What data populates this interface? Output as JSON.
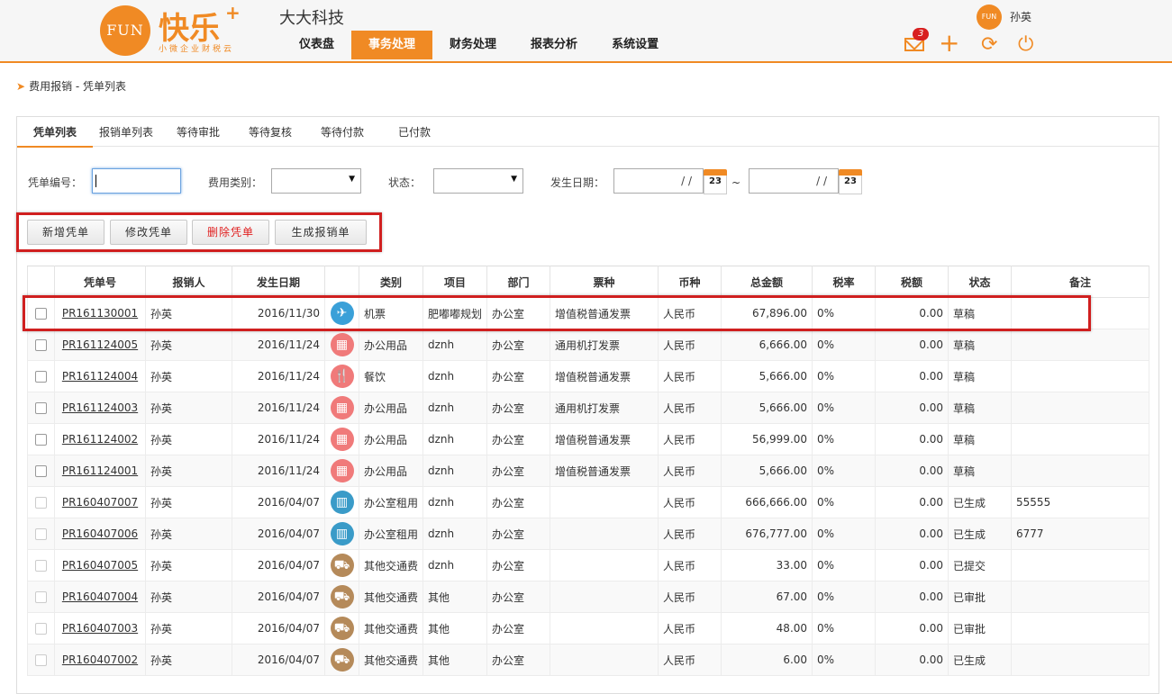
{
  "brand": {
    "logo_circle": "FUN",
    "name": "快乐",
    "plus": "+",
    "slogan": "小微企业财税云",
    "company": "大大科技"
  },
  "nav": [
    "仪表盘",
    "事务处理",
    "财务处理",
    "报表分析",
    "系统设置"
  ],
  "nav_active": "事务处理",
  "user": {
    "avatar": "FUN",
    "name": "孙英"
  },
  "toolbar": {
    "mail_badge": "3",
    "icons": [
      "mail-icon",
      "plus-icon",
      "refresh-icon",
      "power-icon"
    ]
  },
  "breadcrumb": "费用报销 - 凭单列表",
  "tabs": [
    "凭单列表",
    "报销单列表",
    "等待审批",
    "等待复核",
    "等待付款",
    "已付款"
  ],
  "filters": {
    "voucher_no_label": "凭单编号：",
    "category_label": "费用类别：",
    "status_label": "状态：",
    "date_label": "发生日期：",
    "date_placeholder": "/ /",
    "calendar_day": "23",
    "range_sep": "~"
  },
  "buttons": {
    "add": "新增凭单",
    "edit": "修改凭单",
    "delete": "删除凭单",
    "generate": "生成报销单"
  },
  "colors": {
    "accent": "#f08a24",
    "highlight": "#d01f1f",
    "delete_text": "#e02020"
  },
  "table": {
    "headers": [
      "",
      "凭单号",
      "报销人",
      "发生日期",
      "",
      "类别",
      "项目",
      "部门",
      "票种",
      "币种",
      "总金额",
      "税率",
      "税额",
      "状态",
      "备注"
    ],
    "rows": [
      {
        "id": "PR161130001",
        "person": "孙英",
        "date": "2016/11/30",
        "icon": "plane-icon",
        "icon_color": "#3aa0d8",
        "category": "机票",
        "project": "肥嘟嘟规划",
        "dept": "办公室",
        "ticket": "增值税普通发票",
        "currency": "人民币",
        "amount": "67,896.00",
        "tax_rate": "0%",
        "tax": "0.00",
        "status": "草稿",
        "note": ""
      },
      {
        "id": "PR161124005",
        "person": "孙英",
        "date": "2016/11/24",
        "icon": "calculator-icon",
        "icon_color": "#f07a7a",
        "category": "办公用品",
        "project": "dznh",
        "dept": "办公室",
        "ticket": "通用机打发票",
        "currency": "人民币",
        "amount": "6,666.00",
        "tax_rate": "0%",
        "tax": "0.00",
        "status": "草稿",
        "note": ""
      },
      {
        "id": "PR161124004",
        "person": "孙英",
        "date": "2016/11/24",
        "icon": "dining-icon",
        "icon_color": "#f07a7a",
        "category": "餐饮",
        "project": "dznh",
        "dept": "办公室",
        "ticket": "增值税普通发票",
        "currency": "人民币",
        "amount": "5,666.00",
        "tax_rate": "0%",
        "tax": "0.00",
        "status": "草稿",
        "note": ""
      },
      {
        "id": "PR161124003",
        "person": "孙英",
        "date": "2016/11/24",
        "icon": "calculator-icon",
        "icon_color": "#f07a7a",
        "category": "办公用品",
        "project": "dznh",
        "dept": "办公室",
        "ticket": "通用机打发票",
        "currency": "人民币",
        "amount": "5,666.00",
        "tax_rate": "0%",
        "tax": "0.00",
        "status": "草稿",
        "note": ""
      },
      {
        "id": "PR161124002",
        "person": "孙英",
        "date": "2016/11/24",
        "icon": "calculator-icon",
        "icon_color": "#f07a7a",
        "category": "办公用品",
        "project": "dznh",
        "dept": "办公室",
        "ticket": "增值税普通发票",
        "currency": "人民币",
        "amount": "56,999.00",
        "tax_rate": "0%",
        "tax": "0.00",
        "status": "草稿",
        "note": ""
      },
      {
        "id": "PR161124001",
        "person": "孙英",
        "date": "2016/11/24",
        "icon": "calculator-icon",
        "icon_color": "#f07a7a",
        "category": "办公用品",
        "project": "dznh",
        "dept": "办公室",
        "ticket": "增值税普通发票",
        "currency": "人民币",
        "amount": "5,666.00",
        "tax_rate": "0%",
        "tax": "0.00",
        "status": "草稿",
        "note": ""
      },
      {
        "id": "PR160407007",
        "person": "孙英",
        "date": "2016/04/07",
        "icon": "building-icon",
        "icon_color": "#3a9bc8",
        "category": "办公室租用",
        "project": "dznh",
        "dept": "办公室",
        "ticket": "",
        "currency": "人民币",
        "amount": "666,666.00",
        "tax_rate": "0%",
        "tax": "0.00",
        "status": "已生成",
        "note": "55555"
      },
      {
        "id": "PR160407006",
        "person": "孙英",
        "date": "2016/04/07",
        "icon": "building-icon",
        "icon_color": "#3a9bc8",
        "category": "办公室租用",
        "project": "dznh",
        "dept": "办公室",
        "ticket": "",
        "currency": "人民币",
        "amount": "676,777.00",
        "tax_rate": "0%",
        "tax": "0.00",
        "status": "已生成",
        "note": "6777"
      },
      {
        "id": "PR160407005",
        "person": "孙英",
        "date": "2016/04/07",
        "icon": "truck-icon",
        "icon_color": "#b58a5a",
        "category": "其他交通费",
        "project": "dznh",
        "dept": "办公室",
        "ticket": "",
        "currency": "人民币",
        "amount": "33.00",
        "tax_rate": "0%",
        "tax": "0.00",
        "status": "已提交",
        "note": ""
      },
      {
        "id": "PR160407004",
        "person": "孙英",
        "date": "2016/04/07",
        "icon": "truck-icon",
        "icon_color": "#b58a5a",
        "category": "其他交通费",
        "project": "其他",
        "dept": "办公室",
        "ticket": "",
        "currency": "人民币",
        "amount": "67.00",
        "tax_rate": "0%",
        "tax": "0.00",
        "status": "已审批",
        "note": ""
      },
      {
        "id": "PR160407003",
        "person": "孙英",
        "date": "2016/04/07",
        "icon": "truck-icon",
        "icon_color": "#b58a5a",
        "category": "其他交通费",
        "project": "其他",
        "dept": "办公室",
        "ticket": "",
        "currency": "人民币",
        "amount": "48.00",
        "tax_rate": "0%",
        "tax": "0.00",
        "status": "已审批",
        "note": ""
      },
      {
        "id": "PR160407002",
        "person": "孙英",
        "date": "2016/04/07",
        "icon": "truck-icon",
        "icon_color": "#b58a5a",
        "category": "其他交通费",
        "project": "其他",
        "dept": "办公室",
        "ticket": "",
        "currency": "人民币",
        "amount": "6.00",
        "tax_rate": "0%",
        "tax": "0.00",
        "status": "已生成",
        "note": ""
      }
    ]
  }
}
